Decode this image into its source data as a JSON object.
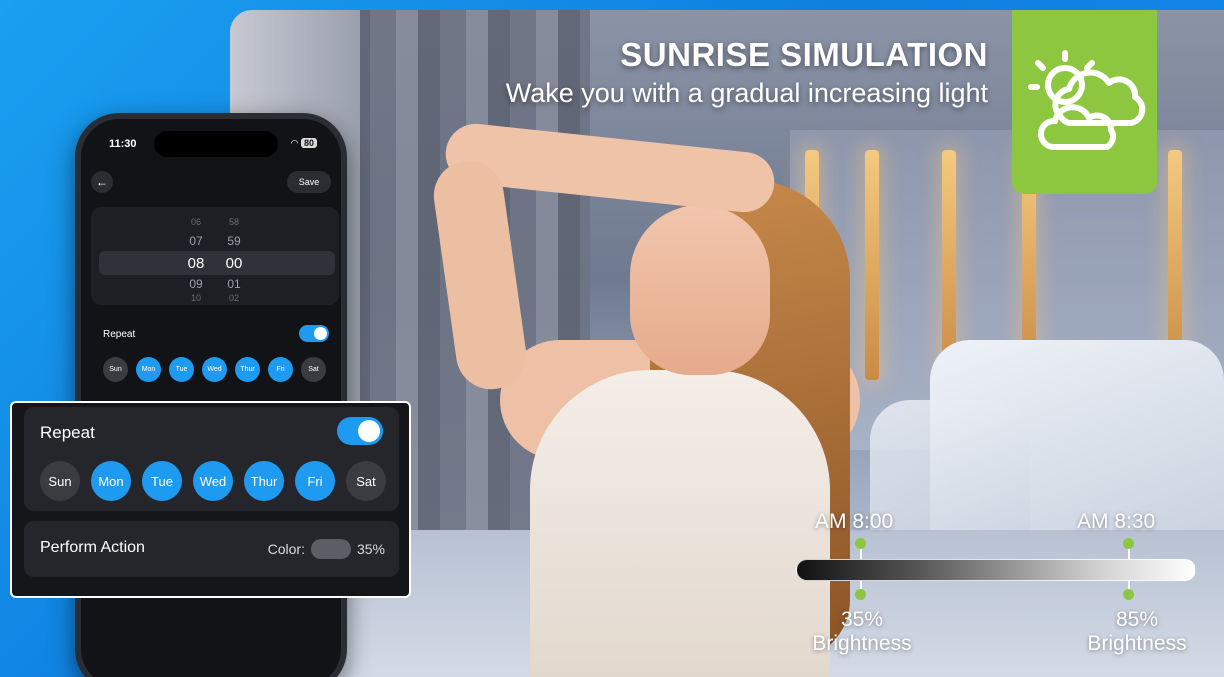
{
  "header": {
    "title": "SUNRISE SIMULATION",
    "subtitle": "Wake you with a gradual increasing light"
  },
  "timeline": {
    "start_time": "AM 8:00",
    "end_time": "AM 8:30",
    "start_brightness": "35%",
    "end_brightness": "85%",
    "brightness_label": "Brightness"
  },
  "phone": {
    "status_time": "11:30",
    "battery": "80",
    "save_label": "Save",
    "picker": {
      "hours": [
        "06",
        "07",
        "08",
        "09",
        "10"
      ],
      "minutes": [
        "58",
        "59",
        "00",
        "01",
        "02"
      ]
    },
    "repeat_label": "Repeat",
    "days": [
      "Sun",
      "Mon",
      "Tue",
      "Wed",
      "Thur",
      "Fri",
      "Sat"
    ]
  },
  "card": {
    "repeat_label": "Repeat",
    "days": [
      {
        "label": "Sun",
        "active": false
      },
      {
        "label": "Mon",
        "active": true
      },
      {
        "label": "Tue",
        "active": true
      },
      {
        "label": "Wed",
        "active": true
      },
      {
        "label": "Thur",
        "active": true
      },
      {
        "label": "Fri",
        "active": true
      },
      {
        "label": "Sat",
        "active": false
      }
    ],
    "action_label": "Perform Action",
    "color_label": "Color:",
    "color_value": "35%"
  },
  "colors": {
    "accent_blue": "#1e9bf0",
    "accent_green": "#8dc63f"
  },
  "icons": {
    "weather": "sun-behind-cloud-icon"
  }
}
